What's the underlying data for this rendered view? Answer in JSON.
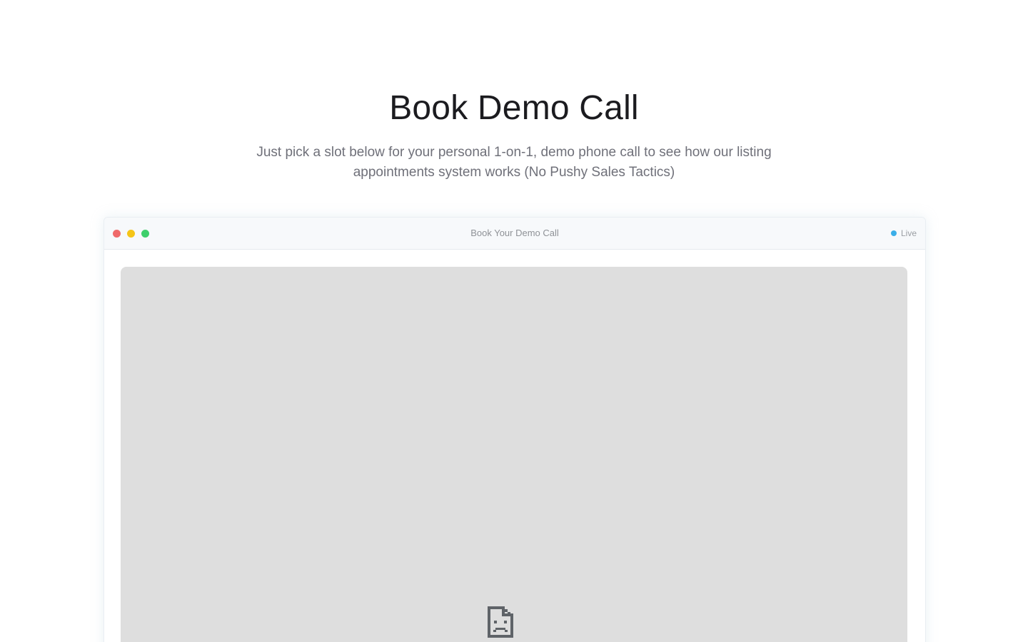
{
  "hero": {
    "title": "Book Demo Call",
    "subtitle": "Just pick a slot below for your personal 1-on-1, demo phone call to see how our listing appointments system works (No Pushy Sales Tactics)"
  },
  "window": {
    "title": "Book Your Demo Call",
    "status_label": "Live",
    "controls": [
      {
        "name": "close",
        "color": "#ef6a6a"
      },
      {
        "name": "minimize",
        "color": "#f5c518"
      },
      {
        "name": "maximize",
        "color": "#3ecf6b"
      }
    ],
    "status_color": "#3aaee8"
  },
  "embed": {
    "state": "failed-to-load",
    "icon": "broken-page-icon"
  }
}
